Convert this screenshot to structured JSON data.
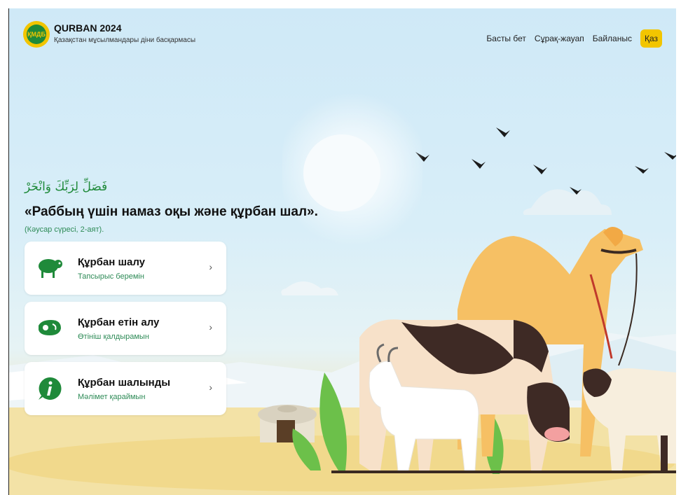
{
  "header": {
    "logo_text": "ҚМДБ",
    "title": "QURBAN 2024",
    "subtitle": "Қазақстан мұсылмандары діни басқармасы",
    "nav": [
      "Басты бет",
      "Сұрақ-жауап",
      "Байланыс"
    ],
    "lang": "Қаз"
  },
  "hero": {
    "arabic": "فَصَلِّ لِرَبِّكَ وَانْحَرْ",
    "quote": "«Раббың үшін намаз оқы және құрбан шал».",
    "source": "(Кәусар сүресі, 2-аят)."
  },
  "cards": [
    {
      "title": "Құрбан шалу",
      "subtitle": "Тапсырыс беремін",
      "icon": "sheep-icon"
    },
    {
      "title": "Құрбан етін алу",
      "subtitle": "Өтініш қалдырамын",
      "icon": "meat-icon"
    },
    {
      "title": "Құрбан шалынды",
      "subtitle": "Мәлімет қараймын",
      "icon": "info-icon"
    }
  ],
  "colors": {
    "accent": "#f2c500",
    "green": "#1f8a3a",
    "sky": "#cfe9f7"
  }
}
